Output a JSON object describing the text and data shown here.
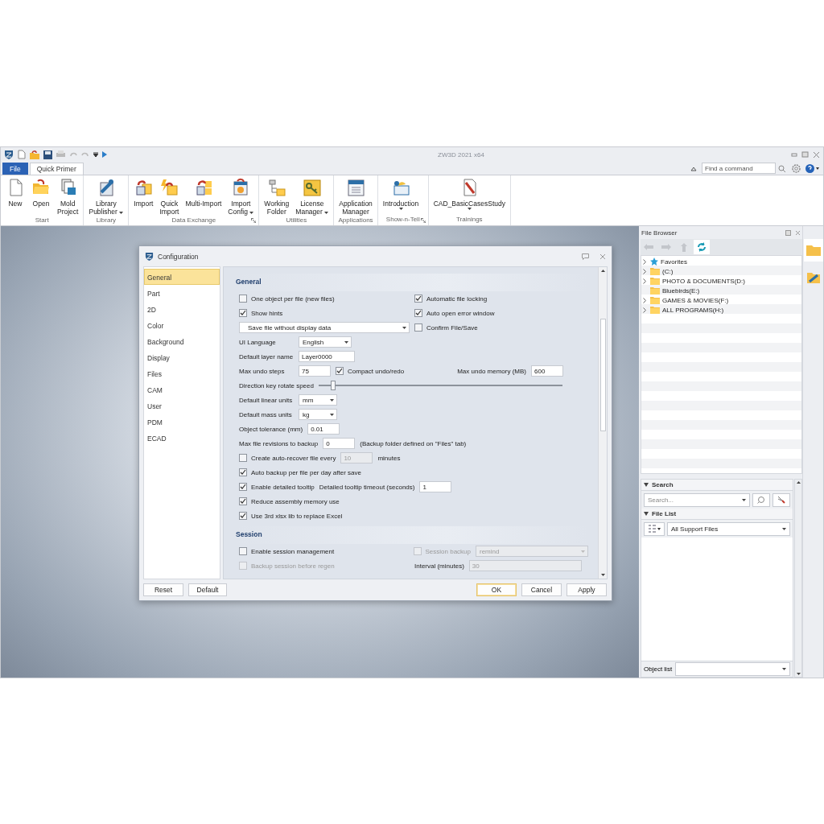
{
  "window": {
    "title": "ZW3D 2021 x64"
  },
  "ribbon": {
    "tabs": [
      {
        "label": "File",
        "kind": "file",
        "selected": false
      },
      {
        "label": "Quick Primer",
        "kind": "tab",
        "selected": true
      }
    ],
    "search": {
      "placeholder": "Find a command"
    },
    "groups": [
      {
        "label": "Start",
        "launcher": false,
        "items": [
          {
            "lines": [
              "New"
            ],
            "kind": "page",
            "dropdown": false
          },
          {
            "lines": [
              "Open"
            ],
            "kind": "folder",
            "dropdown": false
          },
          {
            "lines": [
              "Mold",
              "Project"
            ],
            "kind": "stack",
            "dropdown": false
          }
        ]
      },
      {
        "label": "Library",
        "launcher": false,
        "items": [
          {
            "lines": [
              "Library",
              "Publisher"
            ],
            "kind": "publisher",
            "dropdown": true
          }
        ]
      },
      {
        "label": "Data Exchange",
        "launcher": true,
        "items": [
          {
            "lines": [
              "Import"
            ],
            "kind": "import",
            "dropdown": false
          },
          {
            "lines": [
              "Quick",
              "Import"
            ],
            "kind": "quick",
            "dropdown": false
          },
          {
            "lines": [
              "Multi-Import"
            ],
            "kind": "multi",
            "dropdown": false
          },
          {
            "lines": [
              "Import",
              "Config"
            ],
            "kind": "config",
            "dropdown": true
          }
        ]
      },
      {
        "label": "Utilities",
        "launcher": false,
        "items": [
          {
            "lines": [
              "Working",
              "Folder"
            ],
            "kind": "tree",
            "dropdown": false
          },
          {
            "lines": [
              "License",
              "Manager"
            ],
            "kind": "key",
            "dropdown": true
          }
        ]
      },
      {
        "label": "Applications",
        "launcher": false,
        "items": [
          {
            "lines": [
              "Application",
              "Manager"
            ],
            "kind": "window",
            "dropdown": false
          }
        ]
      },
      {
        "label": "Show-n-Tell",
        "launcher": true,
        "items": [
          {
            "lines": [
              "Introduction"
            ],
            "kind": "board",
            "dropdown": true
          }
        ]
      },
      {
        "label": "Trainings",
        "launcher": false,
        "items": [
          {
            "lines": [
              "CAD_BasicCasesStudy"
            ],
            "kind": "pdf",
            "dropdown": true
          }
        ]
      }
    ]
  },
  "dialog": {
    "title": "Configuration",
    "nav": [
      {
        "label": "General",
        "selected": true
      },
      {
        "label": "Part",
        "selected": false
      },
      {
        "label": "2D",
        "selected": false
      },
      {
        "label": "Color",
        "selected": false
      },
      {
        "label": "Background",
        "selected": false
      },
      {
        "label": "Display",
        "selected": false
      },
      {
        "label": "Files",
        "selected": false
      },
      {
        "label": "CAM",
        "selected": false
      },
      {
        "label": "User",
        "selected": false
      },
      {
        "label": "PDM",
        "selected": false
      },
      {
        "label": "ECAD",
        "selected": false
      }
    ],
    "sections": [
      {
        "title": "General",
        "rows": [
          {
            "cells": [
              {
                "kind": "checkbox",
                "label": "One object per file (new files)",
                "checked": false,
                "disabled": false
              }
            ],
            "right": [
              {
                "kind": "checkbox",
                "label": "Automatic file locking",
                "checked": true,
                "disabled": false
              }
            ]
          },
          {
            "cells": [
              {
                "kind": "checkbox",
                "label": "Show hints",
                "checked": true,
                "disabled": false
              }
            ],
            "right": [
              {
                "kind": "checkbox",
                "label": "Auto open error window",
                "checked": true,
                "disabled": false
              }
            ]
          },
          {
            "cells": [
              {
                "kind": "wide-select",
                "value": "Save file without display data",
                "disabled": false
              }
            ],
            "right": [
              {
                "kind": "checkbox",
                "label": "Confirm File/Save",
                "checked": false,
                "disabled": false
              }
            ]
          },
          {
            "cells": [
              {
                "kind": "label",
                "text": "UI Language"
              },
              {
                "kind": "select",
                "value": "English",
                "disabled": false
              }
            ]
          },
          {
            "cells": [
              {
                "kind": "label",
                "text": "Default layer name"
              },
              {
                "kind": "input",
                "value": "Layer0000",
                "disabled": false
              }
            ]
          },
          {
            "cells": [
              {
                "kind": "label",
                "text": "Max undo steps"
              },
              {
                "kind": "input",
                "value": "75",
                "disabled": false
              },
              {
                "kind": "checkbox",
                "label": "Compact undo/redo",
                "checked": true,
                "disabled": false
              }
            ],
            "end": [
              {
                "kind": "label",
                "text": "Max undo memory (MB)"
              },
              {
                "kind": "input",
                "value": "600",
                "disabled": false
              }
            ]
          },
          {
            "cells": [
              {
                "kind": "label",
                "text": "Direction key rotate speed"
              },
              {
                "kind": "slider",
                "level": 0.06
              }
            ]
          },
          {
            "cells": [
              {
                "kind": "label",
                "text": "Default linear units"
              },
              {
                "kind": "select",
                "value": "mm",
                "disabled": false
              }
            ]
          },
          {
            "cells": [
              {
                "kind": "label",
                "text": "Default mass units"
              },
              {
                "kind": "select",
                "value": "kg",
                "disabled": false
              }
            ]
          },
          {
            "cells": [
              {
                "kind": "label",
                "text": "Object tolerance  (mm)"
              },
              {
                "kind": "input",
                "value": "0.01",
                "disabled": false
              }
            ]
          },
          {
            "cells": [
              {
                "kind": "label",
                "text": "Max file revisions to backup"
              },
              {
                "kind": "input",
                "value": "0",
                "disabled": false
              },
              {
                "kind": "text",
                "text": "(Backup folder defined on \"Files\" tab)"
              }
            ]
          },
          {
            "cells": [
              {
                "kind": "checkbox",
                "label": "Create auto-recover file every",
                "checked": false,
                "disabled": false
              },
              {
                "kind": "input",
                "value": "10",
                "disabled": true
              },
              {
                "kind": "text",
                "text": "minutes"
              }
            ]
          },
          {
            "cells": [
              {
                "kind": "checkbox",
                "label": "Auto backup per file per day after save",
                "checked": true,
                "disabled": false
              }
            ]
          },
          {
            "cells": [
              {
                "kind": "checkbox",
                "label": "Enable detailed tooltip",
                "checked": true,
                "disabled": false
              },
              {
                "kind": "text",
                "text": "Detailed tooltip timeout (seconds)"
              },
              {
                "kind": "input",
                "value": "1",
                "disabled": false
              }
            ]
          },
          {
            "cells": [
              {
                "kind": "checkbox",
                "label": "Reduce assembly memory use",
                "checked": true,
                "disabled": false
              }
            ]
          },
          {
            "cells": [
              {
                "kind": "checkbox",
                "label": "Use 3rd xlsx lib to replace Excel",
                "checked": true,
                "disabled": false
              }
            ]
          }
        ]
      },
      {
        "title": "Session",
        "rows": [
          {
            "cells": [
              {
                "kind": "checkbox",
                "label": "Enable session management",
                "checked": false,
                "disabled": false
              }
            ],
            "right": [
              {
                "kind": "checkbox",
                "label": "Session backup",
                "checked": false,
                "disabled": true
              },
              {
                "kind": "long-select",
                "value": "remind",
                "disabled": true
              }
            ]
          },
          {
            "cells": [
              {
                "kind": "checkbox",
                "label": "Backup session before regen",
                "checked": false,
                "disabled": true
              }
            ],
            "right": [
              {
                "kind": "text",
                "text": "Interval (minutes)"
              },
              {
                "kind": "long-input",
                "value": "30",
                "disabled": true
              }
            ]
          }
        ]
      }
    ],
    "buttons_left": [
      {
        "label": "Reset",
        "default": false
      },
      {
        "label": "Default",
        "default": false
      }
    ],
    "buttons_right": [
      {
        "label": "OK",
        "default": true
      },
      {
        "label": "Cancel",
        "default": false
      },
      {
        "label": "Apply",
        "default": false
      }
    ]
  },
  "file_browser": {
    "title": "File Browser",
    "tree": [
      {
        "label": "Favorites",
        "kind": "star",
        "expandable": true
      },
      {
        "label": "(C:)",
        "kind": "folder",
        "expandable": true
      },
      {
        "label": "PHOTO & DOCUMENTS(D:)",
        "kind": "folder",
        "expandable": true
      },
      {
        "label": "Bluebirds(E:)",
        "kind": "folder",
        "expandable": false
      },
      {
        "label": "GAMES & MOVIES(F:)",
        "kind": "folder",
        "expandable": true
      },
      {
        "label": "ALL PROGRAMS(H:)",
        "kind": "folder",
        "expandable": true
      }
    ],
    "search": {
      "title": "Search",
      "placeholder": "Search..."
    },
    "file_list": {
      "title": "File List",
      "filter": "All Support Files"
    },
    "object_list": {
      "label": "Object list"
    }
  }
}
